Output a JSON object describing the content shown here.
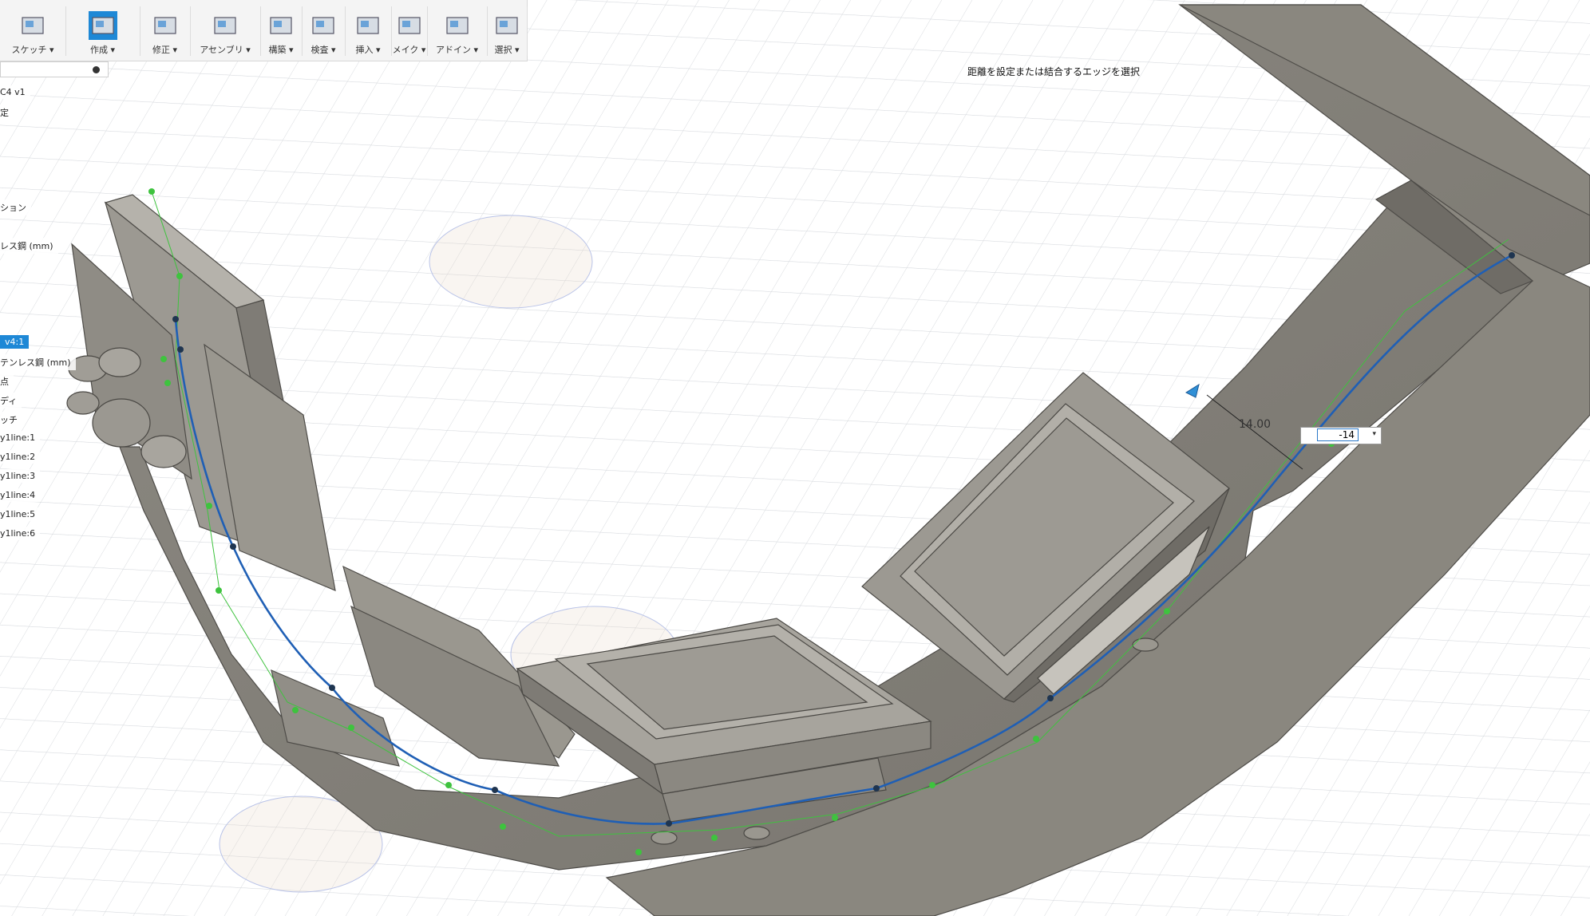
{
  "toolbar": {
    "groups": [
      {
        "label": "スケッチ ▾",
        "icon": "sketch-icon"
      },
      {
        "label": "作成 ▾",
        "icon": "create-icon"
      },
      {
        "label": "修正 ▾",
        "icon": "modify-icon"
      },
      {
        "label": "アセンブリ ▾",
        "icon": "assembly-icon"
      },
      {
        "label": "構築 ▾",
        "icon": "construct-icon"
      },
      {
        "label": "検査 ▾",
        "icon": "inspect-icon"
      },
      {
        "label": "挿入 ▾",
        "icon": "insert-icon"
      },
      {
        "label": "メイク ▾",
        "icon": "make-icon"
      },
      {
        "label": "アドイン ▾",
        "icon": "addins-icon"
      },
      {
        "label": "選択 ▾",
        "icon": "select-icon"
      }
    ]
  },
  "browser": {
    "items": [
      "C4 v1",
      "定",
      "ション",
      "レス鋼 (mm)",
      "v4:1",
      "テンレス鋼 (mm)",
      "点",
      "ディ",
      "ッチ",
      "y1line:1",
      "y1line:2",
      "y1line:3",
      "y1line:4",
      "y1line:5",
      "y1line:6"
    ],
    "selected": "v4:1"
  },
  "viewport": {
    "prompt": "距離を設定または結合するエッジを選択",
    "dimension_label": "14.00",
    "dimension_input_value": "-14"
  },
  "colors": {
    "selected_highlight": "#1e88d6",
    "model_gray": "#8f8c85",
    "spline_blue": "#1f5fb5",
    "construction_green": "#3ec33e"
  }
}
